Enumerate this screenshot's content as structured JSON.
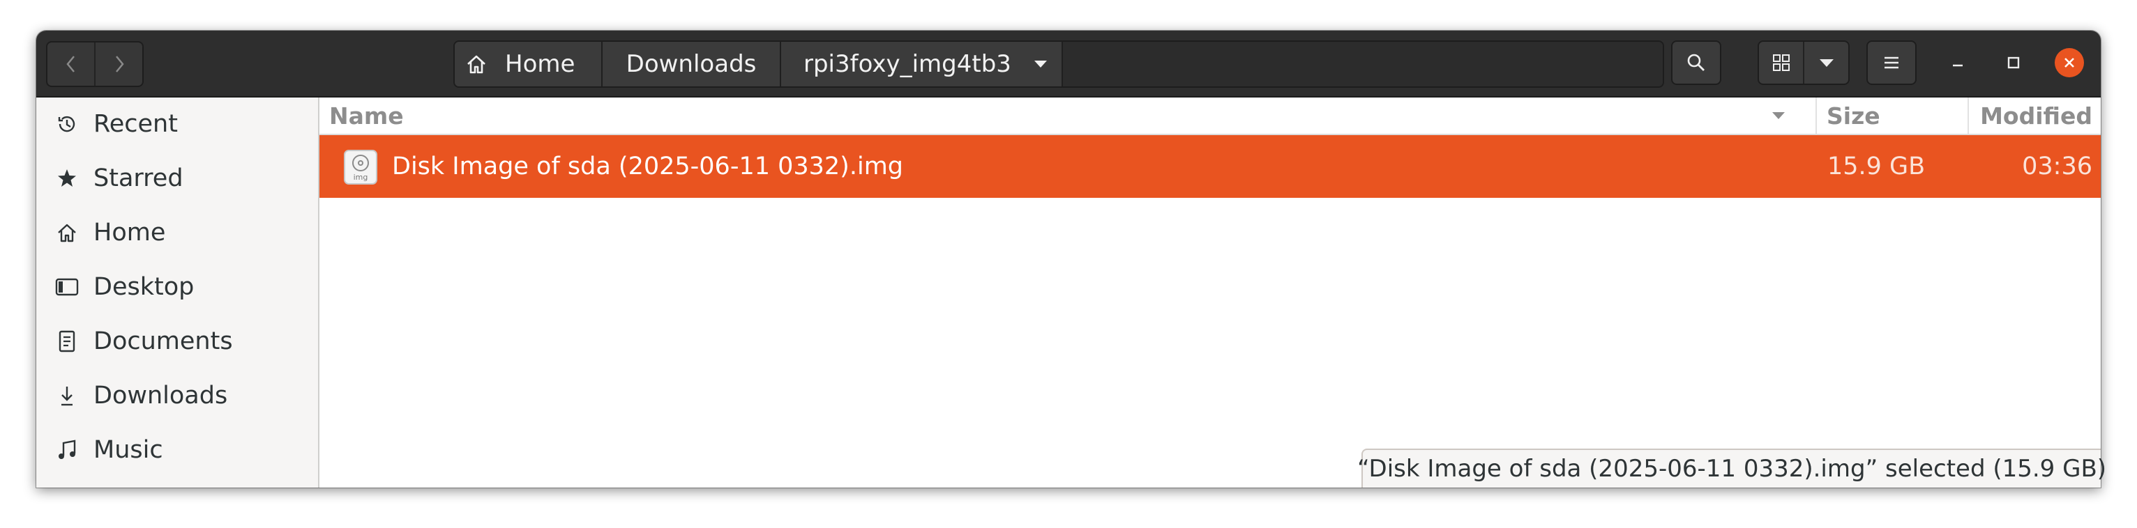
{
  "header": {
    "path": {
      "home_label": "Home",
      "downloads_label": "Downloads",
      "current_label": "rpi3foxy_img4tb3"
    }
  },
  "sidebar": {
    "items": [
      {
        "label": "Recent",
        "icon": "clock-icon"
      },
      {
        "label": "Starred",
        "icon": "star-icon"
      },
      {
        "label": "Home",
        "icon": "home-icon"
      },
      {
        "label": "Desktop",
        "icon": "desktop-icon"
      },
      {
        "label": "Documents",
        "icon": "document-icon"
      },
      {
        "label": "Downloads",
        "icon": "download-icon"
      },
      {
        "label": "Music",
        "icon": "music-icon"
      }
    ]
  },
  "columns": {
    "name": "Name",
    "size": "Size",
    "modified": "Modified"
  },
  "files": [
    {
      "name": "Disk Image of sda (2025-06-11 0332).img",
      "size": "15.9 GB",
      "modified": "03:36",
      "icon_caption": "img",
      "selected": true
    }
  ],
  "status": {
    "text": "“Disk Image of sda (2025-06-11 0332).img” selected (15.9 GB)"
  },
  "colors": {
    "accent": "#e95420",
    "headerbar": "#2e2e2e",
    "sidebar": "#f6f5f4"
  }
}
